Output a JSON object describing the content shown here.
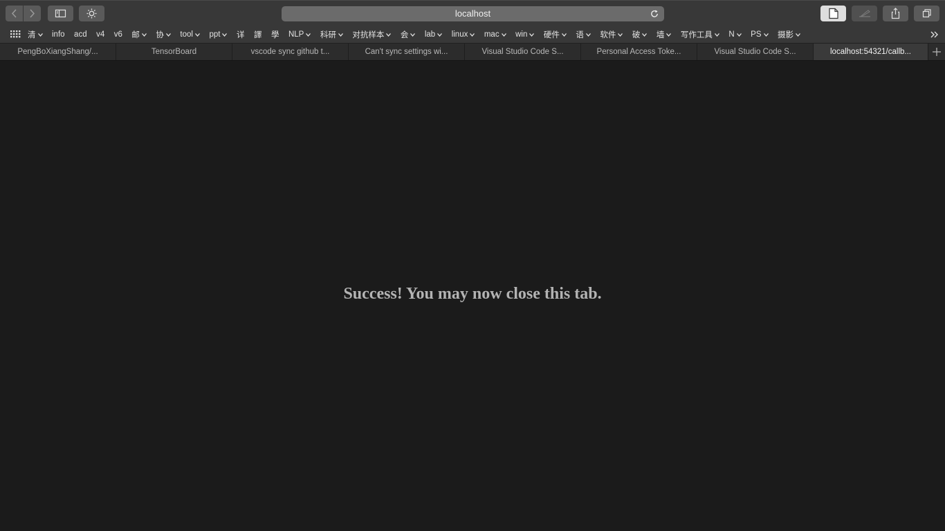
{
  "toolbar": {
    "back_icon": "chevron-left-icon",
    "forward_icon": "chevron-right-icon",
    "sidebar_icon": "sidebar-icon",
    "extension_icon": "sun-icon",
    "reader_icon": "page-icon",
    "markup_icon": "pencil-icon",
    "share_icon": "share-icon",
    "tabs_icon": "tab-overview-icon"
  },
  "address_bar": {
    "url": "localhost",
    "reload_icon": "reload-icon"
  },
  "bookmarks": [
    {
      "label": "清",
      "menu": true
    },
    {
      "label": "info",
      "menu": false
    },
    {
      "label": "acd",
      "menu": false
    },
    {
      "label": "v4",
      "menu": false
    },
    {
      "label": "v6",
      "menu": false
    },
    {
      "label": "邮",
      "menu": true
    },
    {
      "label": "协",
      "menu": true
    },
    {
      "label": "tool",
      "menu": true
    },
    {
      "label": "ppt",
      "menu": true
    },
    {
      "label": "详",
      "menu": false
    },
    {
      "label": "譯",
      "menu": false
    },
    {
      "label": "學",
      "menu": false
    },
    {
      "label": "NLP",
      "menu": true
    },
    {
      "label": "科研",
      "menu": true
    },
    {
      "label": "对抗样本",
      "menu": true
    },
    {
      "label": "会",
      "menu": true
    },
    {
      "label": "lab",
      "menu": true
    },
    {
      "label": "linux",
      "menu": true
    },
    {
      "label": "mac",
      "menu": true
    },
    {
      "label": "win",
      "menu": true
    },
    {
      "label": "硬件",
      "menu": true
    },
    {
      "label": "语",
      "menu": true
    },
    {
      "label": "软件",
      "menu": true
    },
    {
      "label": "破",
      "menu": true
    },
    {
      "label": "墙",
      "menu": true
    },
    {
      "label": "写作工具",
      "menu": true
    },
    {
      "label": "N",
      "menu": true
    },
    {
      "label": "PS",
      "menu": true
    },
    {
      "label": "摄影",
      "menu": true
    }
  ],
  "bookmarks_overflow": ">>",
  "tabs": [
    {
      "label": "PengBoXiangShang/...",
      "active": false
    },
    {
      "label": "TensorBoard",
      "active": false
    },
    {
      "label": "vscode sync github t...",
      "active": false
    },
    {
      "label": "Can't sync settings wi...",
      "active": false
    },
    {
      "label": "Visual Studio Code S...",
      "active": false
    },
    {
      "label": "Personal Access Toke...",
      "active": false
    },
    {
      "label": "Visual Studio Code S...",
      "active": false
    },
    {
      "label": "localhost:54321/callb...",
      "active": true
    }
  ],
  "new_tab_icon": "plus-icon",
  "page": {
    "message": "Success! You may now close this tab."
  }
}
